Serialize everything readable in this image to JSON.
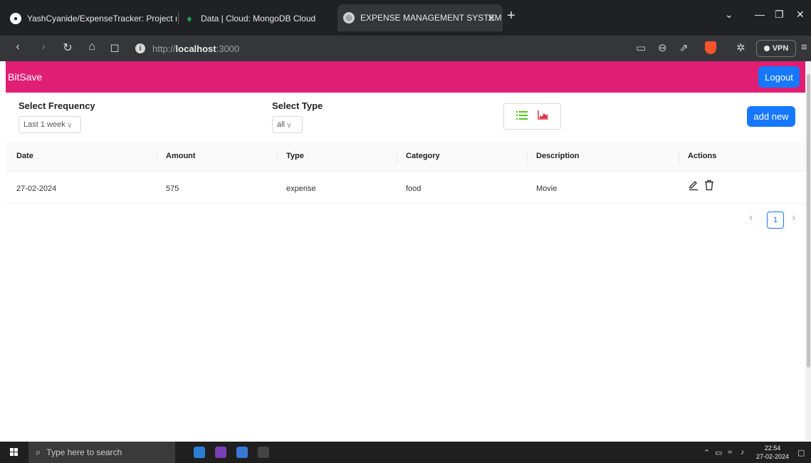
{
  "browser": {
    "tabs": [
      {
        "title": "YashCyanide/ExpenseTracker: Project ma",
        "icon": "github-icon"
      },
      {
        "title": "Data | Cloud: MongoDB Cloud",
        "icon": "mongodb-leaf-icon"
      },
      {
        "title": "EXPENSE MANAGEMENT SYSTEM",
        "icon": "globe-icon",
        "active": true
      }
    ],
    "url_scheme": "http://",
    "url_host": "localhost",
    "url_port": ":3000",
    "vpn_label": "VPN"
  },
  "app": {
    "brand": "BitSave",
    "logout_label": "Logout",
    "header_color": "#e01e74",
    "accent": "#1677ff"
  },
  "filters": {
    "frequency_label": "Select Frequency",
    "frequency_value": "Last 1 week",
    "type_label": "Select Type",
    "type_value": "all",
    "add_new_label": "add new"
  },
  "table": {
    "columns": [
      "Date",
      "Amount",
      "Type",
      "Category",
      "Description",
      "Actions"
    ],
    "rows": [
      {
        "date": "27-02-2024",
        "amount": "575",
        "type": "expense",
        "category": "food",
        "description": "Movie"
      }
    ]
  },
  "pagination": {
    "current_page": "1"
  },
  "taskbar": {
    "search_placeholder": "Type here to search",
    "time": "22:54",
    "date": "27-02-2024"
  }
}
